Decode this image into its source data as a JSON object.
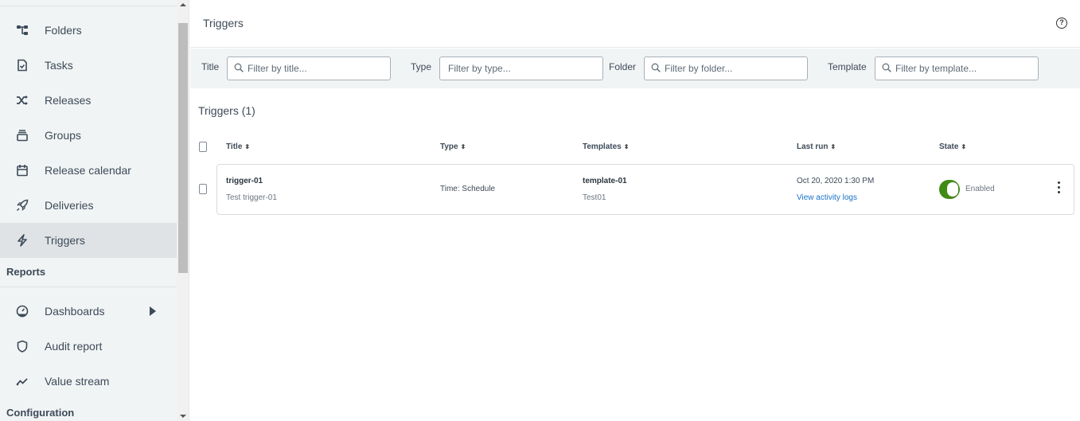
{
  "sidebar": {
    "items": [
      {
        "label": "Folders",
        "icon": "folder-tree-icon"
      },
      {
        "label": "Tasks",
        "icon": "task-file-icon"
      },
      {
        "label": "Releases",
        "icon": "shuffle-icon"
      },
      {
        "label": "Groups",
        "icon": "stack-icon"
      },
      {
        "label": "Release calendar",
        "icon": "calendar-icon"
      },
      {
        "label": "Deliveries",
        "icon": "rocket-icon"
      },
      {
        "label": "Triggers",
        "icon": "lightning-icon",
        "active": true
      }
    ],
    "reports_section": "Reports",
    "report_items": [
      {
        "label": "Dashboards",
        "icon": "dashboard-gauge-icon",
        "has_submenu": true
      },
      {
        "label": "Audit report",
        "icon": "shield-icon"
      },
      {
        "label": "Value stream",
        "icon": "trend-line-icon"
      }
    ],
    "configuration_section": "Configuration"
  },
  "header": {
    "title": "Triggers",
    "help_icon": "help-circle-icon",
    "help_glyph": "?"
  },
  "filters": {
    "title": {
      "label": "Title",
      "placeholder": "Filter by title...",
      "value": ""
    },
    "type": {
      "label": "Type",
      "placeholder": "Filter by type...",
      "value": ""
    },
    "folder": {
      "label": "Folder",
      "placeholder": "Filter by folder...",
      "value": ""
    },
    "template": {
      "label": "Template",
      "placeholder": "Filter by template...",
      "value": ""
    }
  },
  "list": {
    "title": "Triggers (1)",
    "sort_glyph": "⬍",
    "columns": [
      "Title",
      "Type",
      "Templates",
      "Last run",
      "State"
    ],
    "rows": [
      {
        "title": "trigger-01",
        "description": "Test trigger-01",
        "type": "Time: Schedule",
        "template": "template-01",
        "template_sub": "Test01",
        "last_run": "Oct 20, 2020 1:30 PM",
        "activity_link": "View activity logs",
        "state": "Enabled",
        "enabled": true
      }
    ]
  },
  "colors": {
    "accent_green": "#418a16",
    "link_blue": "#1a73c8",
    "sidebar_bg": "#f1f4f5",
    "active_item_bg": "#dfe3e5"
  }
}
